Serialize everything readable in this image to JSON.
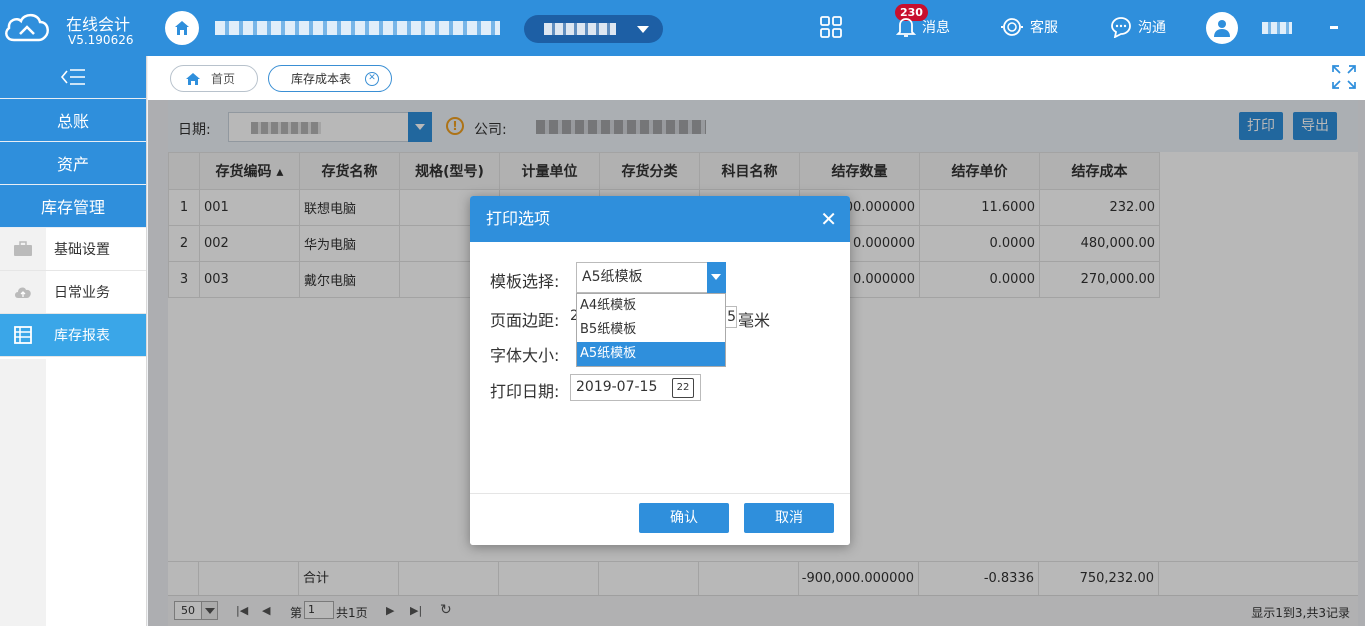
{
  "brand": {
    "name": "在线会计",
    "version": "V5.190626"
  },
  "topbar": {
    "messages_label": "消息",
    "messages_badge": "230",
    "service_label": "客服",
    "chat_label": "沟通"
  },
  "sidebar": {
    "items": [
      {
        "label": "总账"
      },
      {
        "label": "资产"
      },
      {
        "label": "库存管理"
      }
    ],
    "subitems": [
      {
        "label": "基础设置"
      },
      {
        "label": "日常业务"
      },
      {
        "label": "库存报表"
      }
    ]
  },
  "tabs": {
    "home": "首页",
    "current": "库存成本表"
  },
  "filter": {
    "date_label": "日期:",
    "company_label": "公司:",
    "print_label": "打印",
    "export_label": "导出"
  },
  "table": {
    "columns": [
      "存货编码",
      "存货名称",
      "规格(型号)",
      "计量单位",
      "存货分类",
      "科目名称",
      "结存数量",
      "结存单价",
      "结存成本"
    ],
    "rows": [
      {
        "n": "1",
        "code": "001",
        "name": "联想电脑",
        "qty": "000.000000",
        "price": "11.6000",
        "cost": "232.00"
      },
      {
        "n": "2",
        "code": "002",
        "name": "华为电脑",
        "qty": "0.000000",
        "price": "0.0000",
        "cost": "480,000.00"
      },
      {
        "n": "3",
        "code": "003",
        "name": "戴尔电脑",
        "qty": "0.000000",
        "price": "0.0000",
        "cost": "270,000.00"
      }
    ],
    "summary": {
      "label": "合计",
      "qty": "-900,000.000000",
      "price": "-0.8336",
      "cost": "750,232.00"
    }
  },
  "pager": {
    "page_size": "50",
    "page_prefix": "第",
    "page_value": "1",
    "page_suffix": "共1页",
    "summary": "显示1到3,共3记录"
  },
  "dialog": {
    "title": "打印选项",
    "template_label": "模板选择:",
    "template_value": "A5纸模板",
    "template_options": [
      "A4纸模板",
      "B5纸模板",
      "A5纸模板"
    ],
    "margin_label": "页面边距:",
    "margin_prefix": "2",
    "margin_value": "5",
    "margin_unit": "毫米",
    "font_label": "字体大小:",
    "date_label": "打印日期:",
    "date_value": "2019-07-15",
    "calendar_day": "22",
    "confirm_label": "确认",
    "cancel_label": "取消"
  }
}
